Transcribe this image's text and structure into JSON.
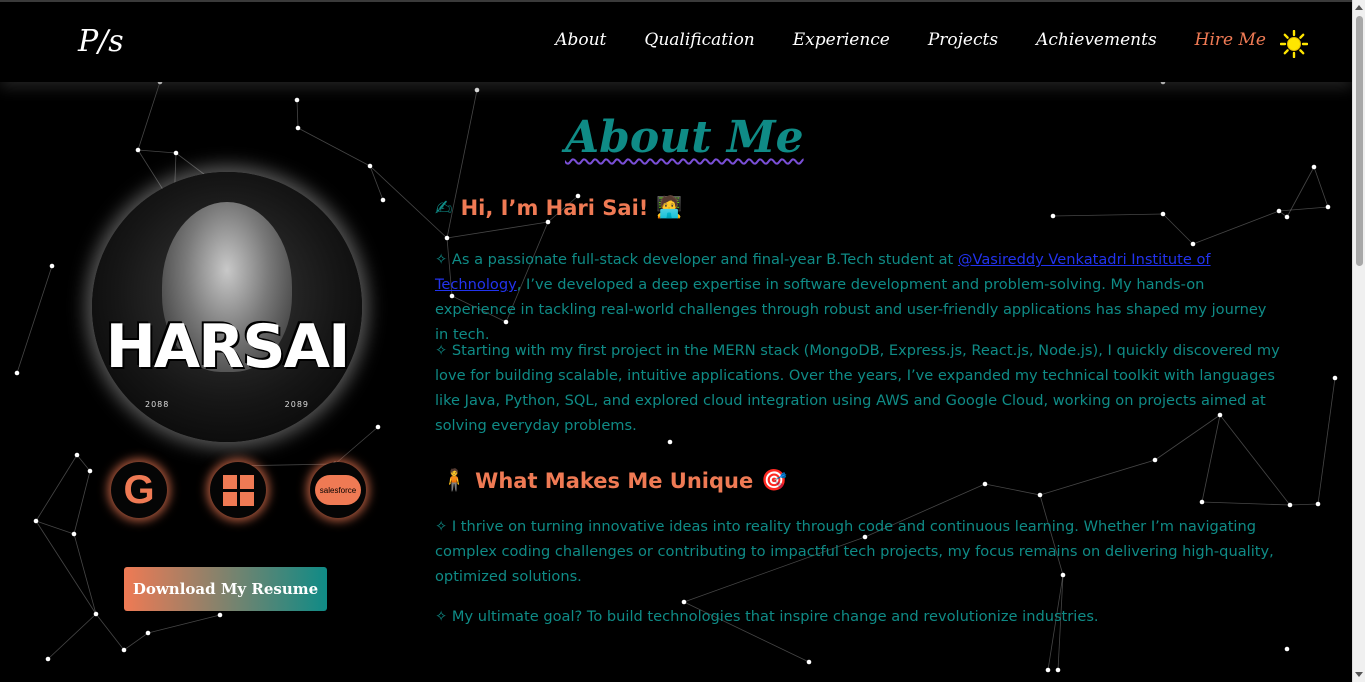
{
  "nav": {
    "logo": "P/s",
    "links": [
      "About",
      "Qualification",
      "Experience",
      "Projects",
      "Achievements"
    ],
    "hire": "Hire Me",
    "theme_icon": "sun-icon"
  },
  "profile": {
    "avatar_text": "HARSAI",
    "year_left": "2088",
    "year_right": "2089",
    "badges": [
      {
        "icon": "google-icon",
        "label": "G"
      },
      {
        "icon": "microsoft-icon",
        "label": ""
      },
      {
        "icon": "salesforce-icon",
        "label": "salesforce"
      }
    ],
    "resume_button": "Download My Resume"
  },
  "about": {
    "title": "About Me",
    "greeting_icon": "✍",
    "greeting": "Hi, I’m Hari Sai!",
    "greeting_emoji": "🧑‍💻",
    "p1_prefix": "✧ As a passionate full-stack developer and final-year B.Tech student at ",
    "p1_link": "@Vasireddy Venkatadri Institute of Technology",
    "p1_suffix": ", I’ve developed a deep expertise in software development and problem-solving. My hands-on experience in tackling real-world challenges through robust and user-friendly applications has shaped my journey in tech.",
    "p2": "✧ Starting with my first project in the MERN stack (MongoDB, Express.js, React.js, Node.js), I quickly discovered my love for building scalable, intuitive applications. Over the years, I’ve expanded my technical toolkit with languages like Java, Python, SQL, and explored cloud integration using AWS and Google Cloud, working on projects aimed at solving everyday problems.",
    "unique_icon": "🧍",
    "unique_title": "What Makes Me Unique",
    "unique_emoji": "🎯",
    "p3": "✧ I thrive on turning innovative ideas into reality through code and continuous learning. Whether I’m navigating complex coding challenges or contributing to impactful tech projects, my focus remains on delivering high-quality, optimized solutions.",
    "p4": "✧ My ultimate goal? To build technologies that inspire change and revolutionize industries."
  },
  "colors": {
    "accent": "#ef7a54",
    "teal": "#0f8b86",
    "link": "#2233ee"
  }
}
